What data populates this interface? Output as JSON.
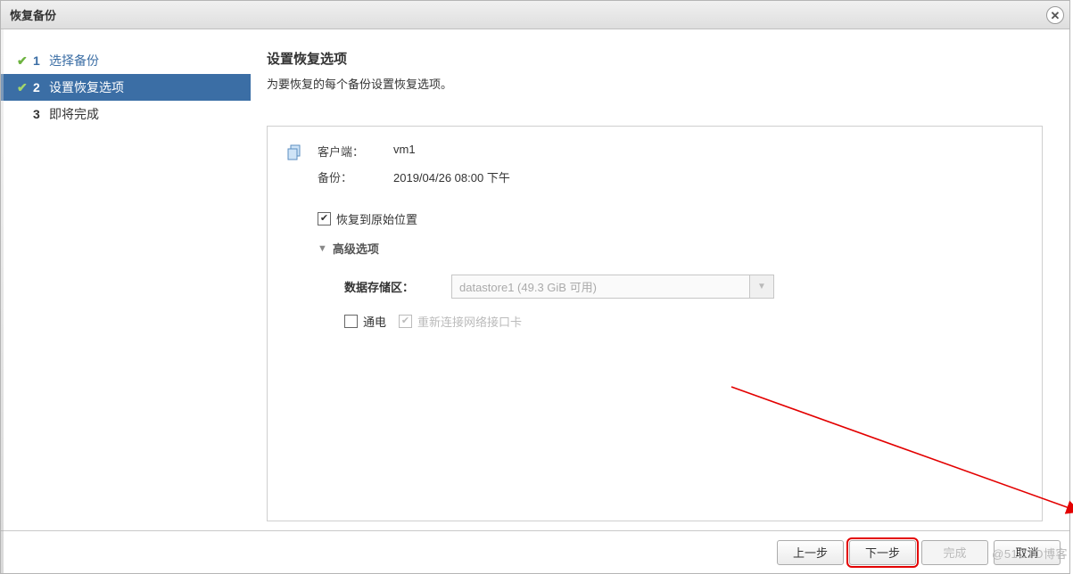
{
  "dialog": {
    "title": "恢复备份"
  },
  "steps": [
    {
      "num": "1",
      "label": "选择备份",
      "done": true
    },
    {
      "num": "2",
      "label": "设置恢复选项",
      "active": true,
      "done": true
    },
    {
      "num": "3",
      "label": "即将完成"
    }
  ],
  "page": {
    "heading": "设置恢复选项",
    "sub": "为要恢复的每个备份设置恢复选项。"
  },
  "details": {
    "client_label": "客户端：",
    "client_value": "vm1",
    "backup_label": "备份：",
    "backup_value": "2019/04/26 08:00 下午",
    "restore_original_label": "恢复到原始位置",
    "restore_original_checked": true,
    "advanced_label": "高级选项",
    "datastore_label": "数据存储区：",
    "datastore_value": "datastore1 (49.3 GiB 可用)",
    "power_on_label": "通电",
    "power_on_checked": false,
    "reconnect_nic_label": "重新连接网络接口卡",
    "reconnect_nic_checked": true
  },
  "footer": {
    "back": "上一步",
    "next": "下一步",
    "finish": "完成",
    "cancel": "取消"
  },
  "watermark": "@51CTO博客"
}
